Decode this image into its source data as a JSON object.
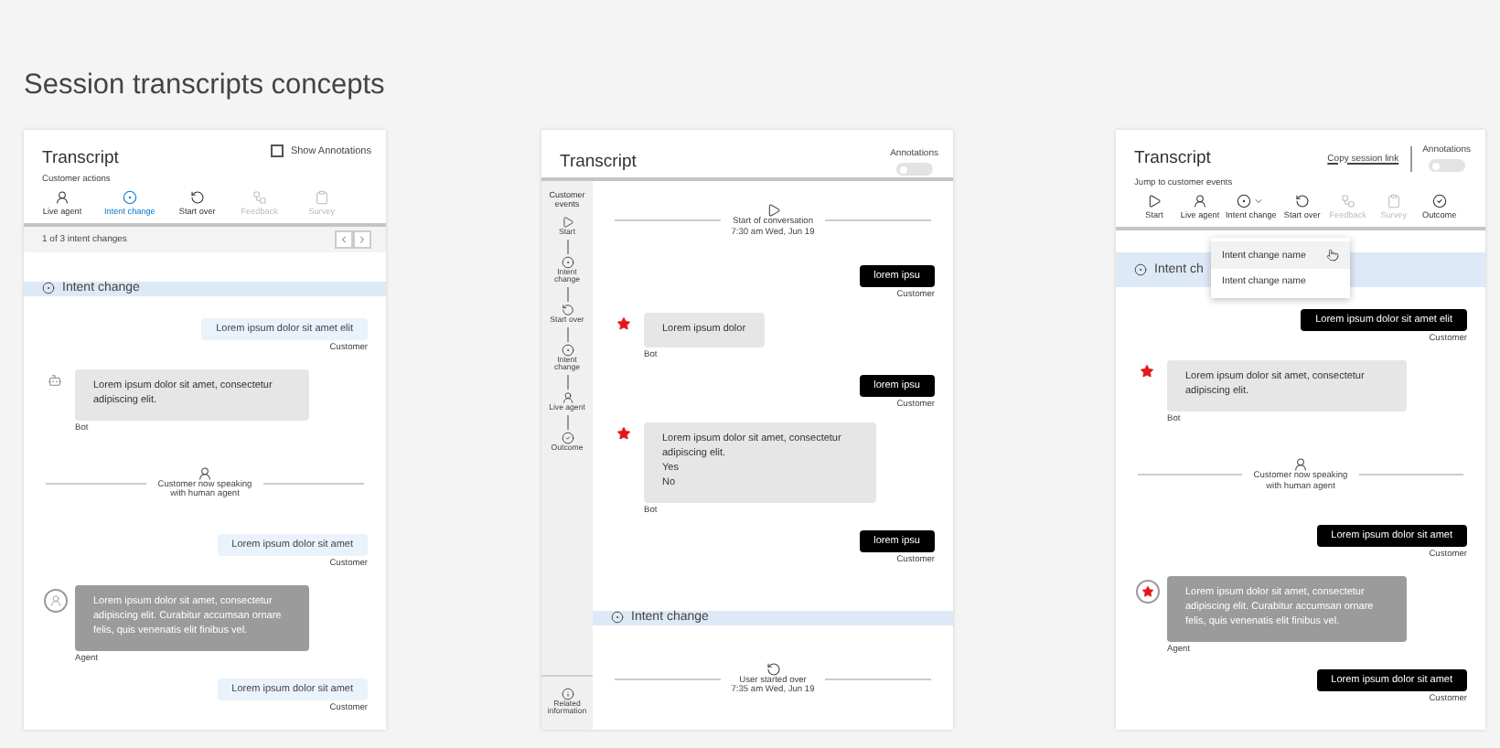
{
  "page_title": "Session transcripts concepts",
  "panels": [
    {
      "title": "Transcript",
      "annotations": {
        "kind": "checkbox",
        "label": "Show Annotations",
        "on": false
      },
      "actions": {
        "label": "Customer actions",
        "items": [
          {
            "kind": "live_agent",
            "label": "Live agent",
            "selected": false,
            "disabled": false
          },
          {
            "kind": "intent",
            "label": "Intent change",
            "selected": true,
            "disabled": false
          },
          {
            "kind": "start_over",
            "label": "Start over",
            "selected": false,
            "disabled": false
          },
          {
            "kind": "feedback",
            "label": "Feedback",
            "selected": false,
            "disabled": true
          },
          {
            "kind": "survey",
            "label": "Survey",
            "selected": false,
            "disabled": true
          }
        ]
      },
      "pager": {
        "text": "1 of 3 intent changes"
      },
      "messages": [
        {
          "kind": "intent",
          "text": "Intent change"
        },
        {
          "kind": "customer",
          "text": "Lorem ipsum dolor sit amet elit",
          "sender": "Customer",
          "dark": false
        },
        {
          "kind": "bot",
          "text": "Lorem ipsum dolor sit amet, consectetur adipiscing elit.",
          "sender": "Bot",
          "starred": false
        },
        {
          "kind": "event_live_agent",
          "lines": [
            "Customer now speaking",
            "with human agent"
          ]
        },
        {
          "kind": "customer",
          "text": "Lorem ipsum dolor sit amet",
          "sender": "Customer",
          "dark": false
        },
        {
          "kind": "agent",
          "text": "Lorem ipsum dolor sit amet, consectetur adipiscing elit. Curabitur accumsan ornare felis, quis venenatis elit finibus vel.",
          "sender": "Agent",
          "starred": false
        },
        {
          "kind": "customer",
          "text": "Lorem ipsum dolor sit amet",
          "sender": "Customer",
          "dark": false
        }
      ]
    },
    {
      "title": "Transcript",
      "annotations": {
        "kind": "toggle",
        "label": "Annotations",
        "on": false
      },
      "sidebar": {
        "label": "Customer events",
        "items": [
          {
            "kind": "start",
            "label": "Start"
          },
          {
            "kind": "intent",
            "label": "Intent change"
          },
          {
            "kind": "start_over",
            "label": "Start over"
          },
          {
            "kind": "intent",
            "label": "Intent change"
          },
          {
            "kind": "live_agent",
            "label": "Live agent"
          },
          {
            "kind": "outcome",
            "label": "Outcome"
          }
        ],
        "footer": "Related information"
      },
      "messages": [
        {
          "kind": "event_start",
          "lines": [
            "Start of conversation",
            "7:30 am  Wed, Jun 19"
          ]
        },
        {
          "kind": "customer",
          "text": "lorem ipsu",
          "sender": "Customer",
          "dark": true
        },
        {
          "kind": "bot",
          "text": "Lorem ipsum dolor",
          "sender": "Bot",
          "starred": true
        },
        {
          "kind": "customer",
          "text": "lorem ipsu",
          "sender": "Customer",
          "dark": true
        },
        {
          "kind": "bot",
          "text": "Lorem ipsum dolor sit amet, consectetur adipiscing elit.",
          "options": [
            "Yes",
            "No"
          ],
          "sender": "Bot",
          "starred": true
        },
        {
          "kind": "customer",
          "text": "lorem ipsu",
          "sender": "Customer",
          "dark": true
        },
        {
          "kind": "intent",
          "text": "Intent change"
        },
        {
          "kind": "event_start_over",
          "lines": [
            "User started over",
            "7:35 am  Wed, Jun 19"
          ]
        }
      ]
    },
    {
      "title": "Transcript",
      "copy_link": "Copy session link",
      "annotations": {
        "kind": "toggle",
        "label": "Annotations",
        "on": false
      },
      "actions": {
        "label": "Jump to customer events",
        "items": [
          {
            "kind": "start",
            "label": "Start",
            "selected": false,
            "disabled": false
          },
          {
            "kind": "live_agent",
            "label": "Live agent",
            "selected": false,
            "disabled": false
          },
          {
            "kind": "intent",
            "label": "Intent change",
            "selected": false,
            "disabled": false,
            "has_menu": true
          },
          {
            "kind": "start_over",
            "label": "Start over",
            "selected": false,
            "disabled": false
          },
          {
            "kind": "feedback",
            "label": "Feedback",
            "selected": false,
            "disabled": true
          },
          {
            "kind": "survey",
            "label": "Survey",
            "selected": false,
            "disabled": true
          },
          {
            "kind": "outcome",
            "label": "Outcome",
            "selected": false,
            "disabled": false
          }
        ]
      },
      "menu": {
        "items": [
          {
            "label": "Intent change name",
            "hovered": true
          },
          {
            "label": "Intent change name",
            "hovered": false
          }
        ]
      },
      "messages": [
        {
          "kind": "intent",
          "text": "Intent ch"
        },
        {
          "kind": "customer",
          "text": "Lorem ipsum dolor sit amet elit",
          "sender": "Customer",
          "dark": true
        },
        {
          "kind": "bot",
          "text": "Lorem ipsum dolor sit amet, consectetur adipiscing elit.",
          "sender": "Bot",
          "starred": true
        },
        {
          "kind": "event_live_agent",
          "lines": [
            "Customer now speaking",
            "with human agent"
          ]
        },
        {
          "kind": "customer",
          "text": "Lorem ipsum dolor sit amet",
          "sender": "Customer",
          "dark": true
        },
        {
          "kind": "agent",
          "text": "Lorem ipsum dolor sit amet, consectetur adipiscing elit. Curabitur accumsan ornare felis, quis venenatis elit finibus vel.",
          "sender": "Agent",
          "starred": true
        },
        {
          "kind": "customer",
          "text": "Lorem ipsum dolor sit amet",
          "sender": "Customer",
          "dark": true
        }
      ]
    }
  ]
}
